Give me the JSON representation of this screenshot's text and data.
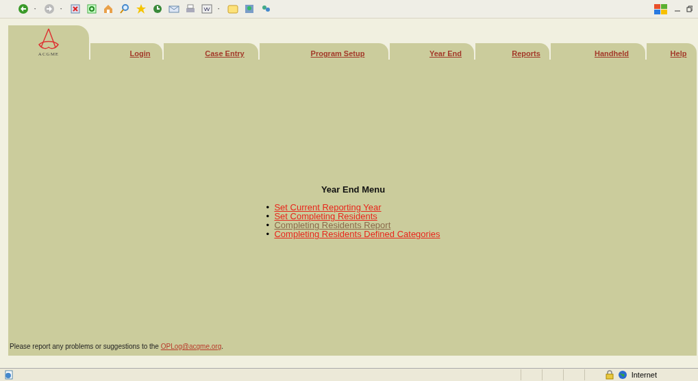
{
  "logo": {
    "text": "ACGME"
  },
  "tabs": [
    {
      "label": "Login"
    },
    {
      "label": "Case Entry"
    },
    {
      "label": "Program Setup"
    },
    {
      "label": "Year End"
    },
    {
      "label": "Reports"
    },
    {
      "label": "Handheld"
    },
    {
      "label": "Help"
    }
  ],
  "menu": {
    "title": "Year End Menu",
    "items": [
      {
        "bullet": "•",
        "label": "Set Current Reporting Year",
        "visited": false
      },
      {
        "bullet": "•",
        "label": "Set Completing Residents",
        "visited": false
      },
      {
        "bullet": "•",
        "label": "Completing Residents Report",
        "visited": true
      },
      {
        "bullet": "•",
        "label": "Completing Residents Defined Categories",
        "visited": false
      }
    ]
  },
  "footer": {
    "text": "Please report any problems or suggestions to the ",
    "link": "OPLog@acgme.org",
    "end": "."
  },
  "status_bar": {
    "zone": "Internet"
  }
}
